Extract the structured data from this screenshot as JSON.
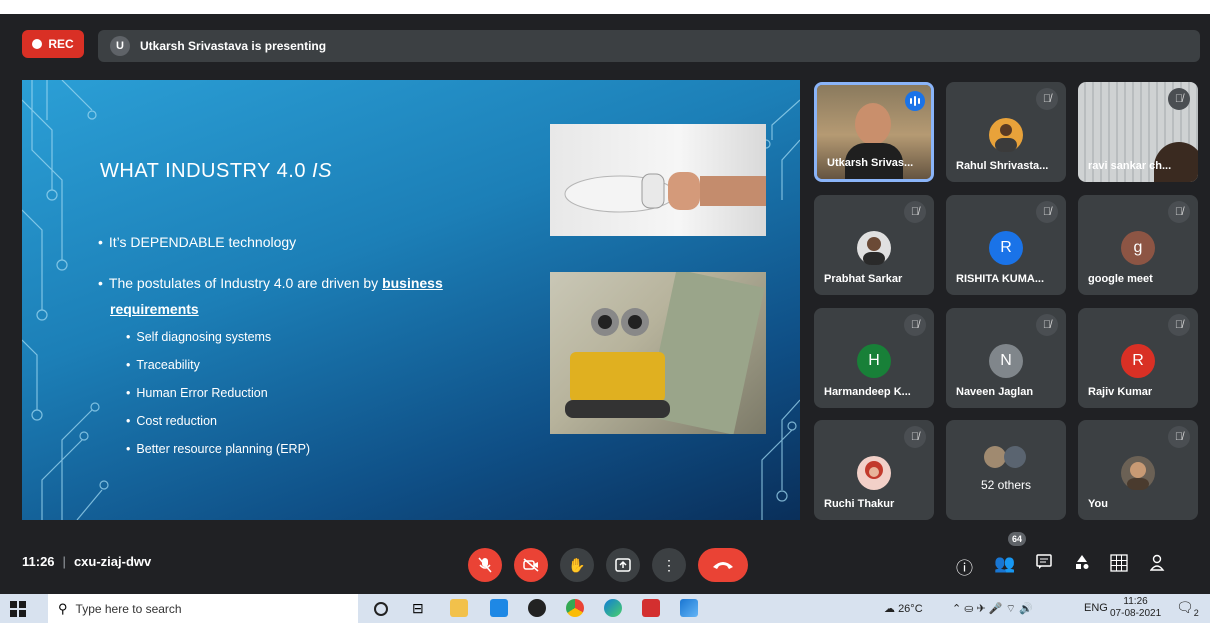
{
  "meeting": {
    "rec_label": "REC",
    "presenter_initial": "U",
    "presenting_text": "Utkarsh Srivastava is presenting",
    "time": "11:26",
    "code": "cxu-ziaj-dwv",
    "participant_count": "64"
  },
  "slide": {
    "title_main": "WHAT INDUSTRY 4.0 ",
    "title_italic": "IS",
    "bullet1": "It’s DEPENDABLE technology",
    "bullet2_prefix": "The postulates of Industry 4.0 are driven by ",
    "bullet2_link_a": "business",
    "bullet2_link_b": "requirements",
    "subs": [
      "Self diagnosing systems",
      "Traceability",
      "Human Error Reduction",
      "Cost reduction",
      "Better resource planning (ERP)"
    ]
  },
  "participants": [
    {
      "name": "Utkarsh Srivas...",
      "type": "video",
      "speaking": true
    },
    {
      "name": "Rahul Shrivasta...",
      "type": "photo",
      "muted": true
    },
    {
      "name": "ravi sankar ch...",
      "type": "video",
      "muted": true
    },
    {
      "name": "Prabhat Sarkar",
      "type": "photo",
      "muted": true
    },
    {
      "name": "RISHITA KUMA...",
      "initial": "R",
      "color": "#1a73e8",
      "muted": true
    },
    {
      "name": "google meet",
      "initial": "g",
      "color": "#8d5544",
      "muted": true
    },
    {
      "name": "Harmandeep K...",
      "initial": "H",
      "color": "#188038",
      "muted": true
    },
    {
      "name": "Naveen Jaglan",
      "initial": "N",
      "color": "#80868b",
      "muted": true
    },
    {
      "name": "Rajiv Kumar",
      "initial": "R",
      "color": "#d93025",
      "muted": true
    },
    {
      "name": "Ruchi Thakur",
      "type": "photo",
      "muted": true
    },
    {
      "name": "52 others",
      "type": "group"
    },
    {
      "name": "You",
      "type": "photo",
      "muted": true
    }
  ],
  "taskbar": {
    "search_placeholder": "Type here to search",
    "temperature": "26°C",
    "lang": "ENG",
    "time": "11:26",
    "date": "07-08-2021",
    "notif_count": "2"
  },
  "colors": {
    "accent": "#1a73e8",
    "danger": "#ea4335",
    "tile_bg": "#3c4043",
    "app_bg": "#202124"
  }
}
